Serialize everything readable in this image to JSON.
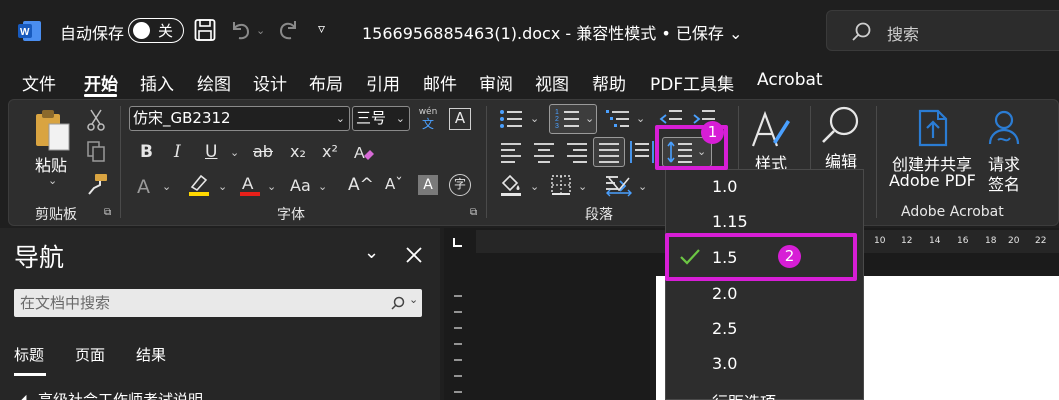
{
  "titlebar": {
    "autosave_label": "自动保存",
    "autosave_state": "关",
    "doc_title": "1566956885463(1).docx  -  兼容性模式 • 已保存 ⌄",
    "search_placeholder": "搜索"
  },
  "menu": [
    "文件",
    "开始",
    "插入",
    "绘图",
    "设计",
    "布局",
    "引用",
    "邮件",
    "审阅",
    "视图",
    "帮助",
    "PDF工具集",
    "Acrobat"
  ],
  "ribbon": {
    "clipboard": {
      "paste_label": "粘贴",
      "group_label": "剪贴板"
    },
    "font": {
      "font_name": "仿宋_GB2312",
      "font_size": "三号",
      "wen_top": "wén",
      "wen_bottom": "文",
      "text_a": "A",
      "bold": "B",
      "italic": "I",
      "underline": "U",
      "strike": "ab",
      "sub": "x₂",
      "sup": "x²",
      "case": "Aa",
      "grow": "A^",
      "shrink": "Aˇ",
      "text_effects": "A",
      "highlight": "A",
      "color": "A",
      "char_shade": "A",
      "enclose": "字",
      "group_label": "字体"
    },
    "paragraph": {
      "group_label": "段落"
    },
    "styles": {
      "label": "样式"
    },
    "editing": {
      "label": "编辑"
    },
    "acrobat": {
      "create_label_line1": "创建并共享",
      "create_label_line2": "Adobe PDF",
      "request_label_line1": "请求",
      "request_label_line2": "签名",
      "group_label": "Adobe Acrobat"
    }
  },
  "nav": {
    "title": "导航",
    "search_placeholder": "在文档中搜索",
    "tabs": [
      "标题",
      "页面",
      "结果"
    ],
    "first_heading": "高级社会工作师考试说明"
  },
  "ruler": {
    "numbers": [
      "10",
      "12",
      "14",
      "16",
      "18",
      "20",
      "22"
    ]
  },
  "dropdown": {
    "items": [
      "1.0",
      "1.15",
      "1.5",
      "2.0",
      "2.5",
      "3.0",
      "行距选项..."
    ],
    "selected": "1.5"
  },
  "annotations": {
    "badge1": "1",
    "badge2": "2",
    "color": "#d71ed6"
  },
  "colors": {
    "accent": "#2b7cd3",
    "highlight_yellow": "#ffd800",
    "font_red": "#e8201a",
    "check_green": "#6cc644"
  }
}
